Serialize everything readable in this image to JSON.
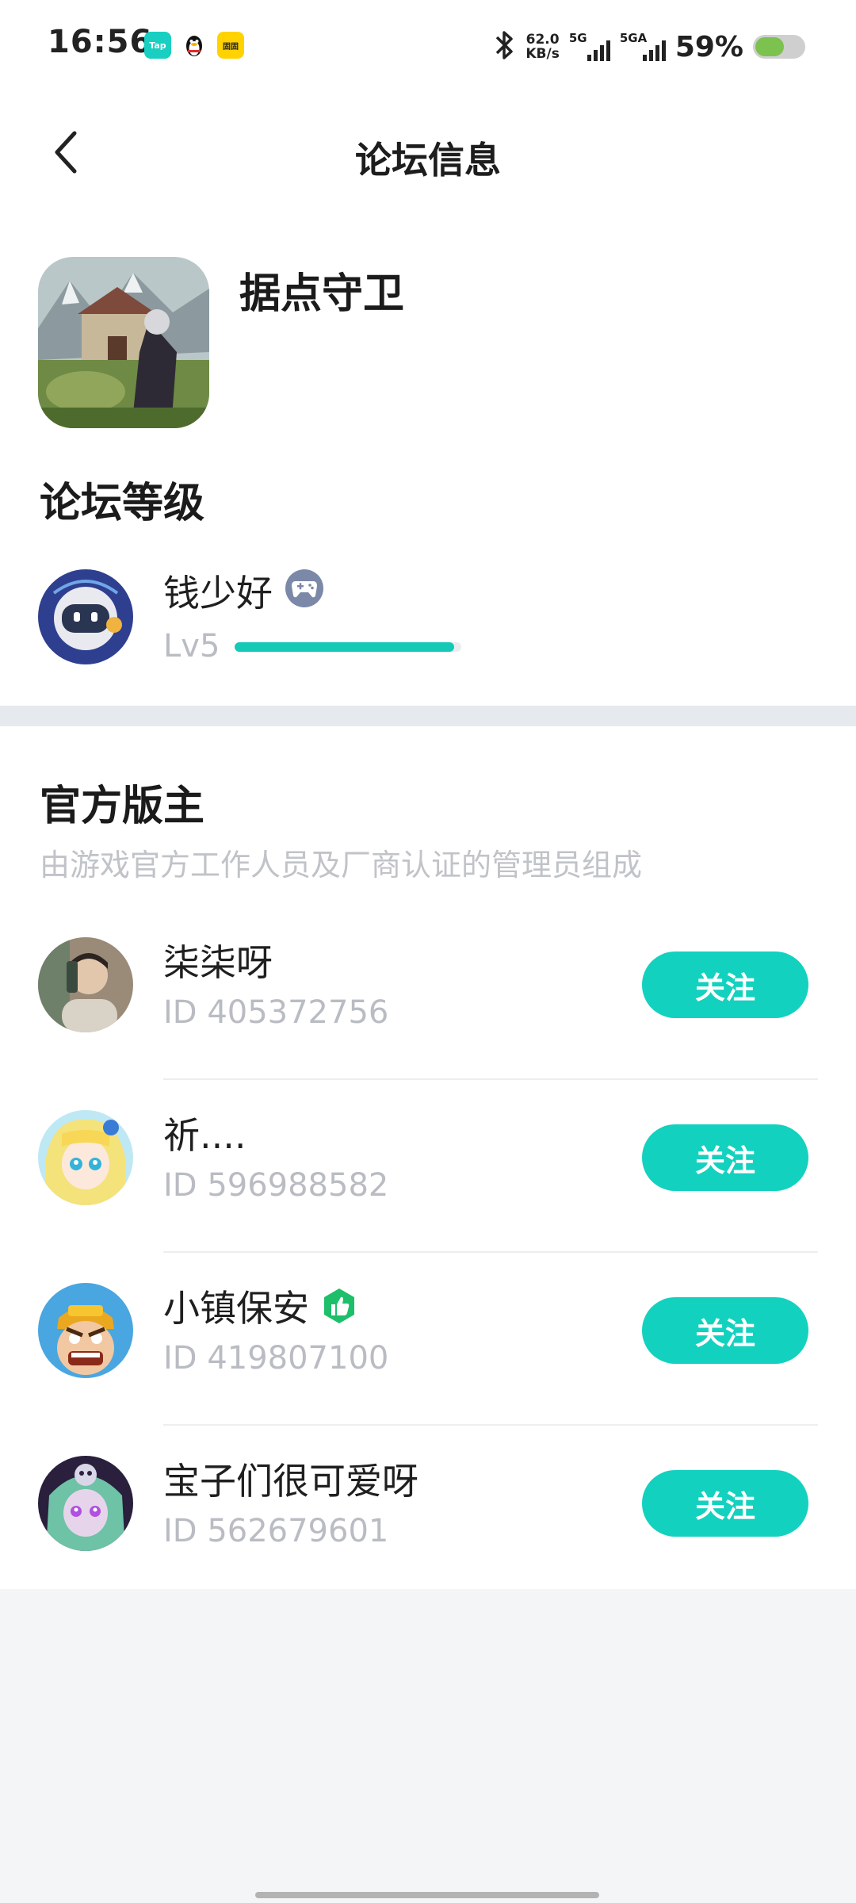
{
  "status_bar": {
    "time": "16:56",
    "app_icons": [
      "Tap",
      "qq-penguin-icon",
      "固固"
    ],
    "net_speed_value": "62.0",
    "net_speed_unit": "KB/s",
    "net1_label": "5G",
    "net2_label": "5GA",
    "battery_percent": "59%",
    "battery_level": 0.59,
    "battery_color": "#7cc24f"
  },
  "header": {
    "title": "论坛信息"
  },
  "forum": {
    "game_name": "据点守卫",
    "level_section_title": "论坛等级",
    "user_name": "钱少好",
    "level_label": "Lv5",
    "level_progress": 0.97
  },
  "moderators": {
    "title": "官方版主",
    "subtitle": "由游戏官方工作人员及厂商认证的管理员组成",
    "follow_label": "关注",
    "items": [
      {
        "name": "柒柒呀",
        "id": "ID 405372756",
        "badge": ""
      },
      {
        "name": "祈....",
        "id": "ID 596988582",
        "badge": ""
      },
      {
        "name": "小镇保安",
        "id": "ID 419807100",
        "badge": "thumbs-up-badge-icon"
      },
      {
        "name": "宝子们很可爱呀",
        "id": "ID 562679601",
        "badge": ""
      }
    ]
  },
  "colors": {
    "accent": "#13d1bf",
    "badge_green": "#1dbf6a",
    "gamepad_badge": "#7c88a8"
  }
}
